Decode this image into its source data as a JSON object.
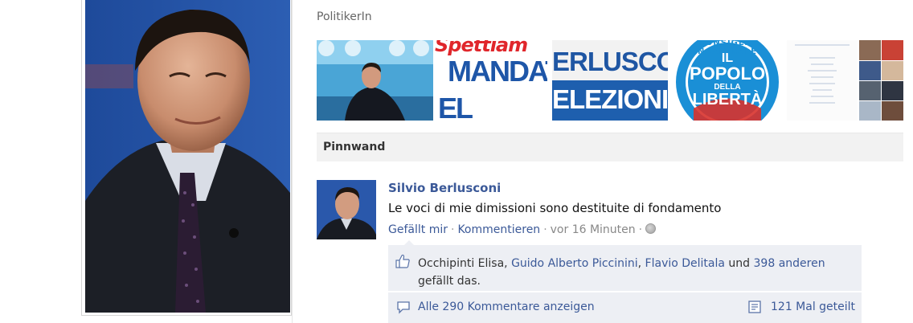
{
  "profile": {
    "category": "PolitikerIn"
  },
  "photo_strip": {
    "tiles": [
      {
        "label": "portrait-at-rally"
      },
      {
        "label": "MANDATO / AL POPOLO poster"
      },
      {
        "label": "BERLUSCONI / ELEZIONI poster"
      },
      {
        "label": "IL POPOLO DELLA LIBERTA logo"
      },
      {
        "label": "document"
      },
      {
        "label": "photo collage"
      }
    ],
    "poster_texts": {
      "tile2_top": "Spettiam",
      "tile2_mid": "MANDAT",
      "tile2_bot": "EL POPOL",
      "tile3_top": "ERLUSCO",
      "tile3_bot": "ELEZIONI",
      "tile4_arc": "CONSIGLIO NAZIONALE",
      "tile4_l1": "IL",
      "tile4_l2": "POPOLO",
      "tile4_l3": "DELLA",
      "tile4_l4": "LIBERTÀ"
    }
  },
  "wall": {
    "title": "Pinnwand"
  },
  "post": {
    "author": "Silvio Berlusconi",
    "text": "Le voci di mie dimissioni sono destituite di fondamento",
    "like_label": "Gefällt mir",
    "comment_label": "Kommentieren",
    "time": "vor 16 Minuten",
    "separator": "·",
    "likes": {
      "name1": "Occhipinti Elisa",
      "comma": ",",
      "name2": "Guido Alberto Piccinini",
      "name3": "Flavio Delitala",
      "and": "und",
      "others": "398 anderen",
      "suffix": "gefällt das."
    },
    "all_comments": "Alle 290 Kommentare anzeigen",
    "shares": "121 Mal geteilt"
  },
  "colors": {
    "link": "#3b5998",
    "like_box_bg": "#edeff4",
    "header_bg": "#f2f2f2"
  },
  "icons": [
    "thumbs-up-icon",
    "comment-icon",
    "share-icon",
    "globe-icon"
  ]
}
